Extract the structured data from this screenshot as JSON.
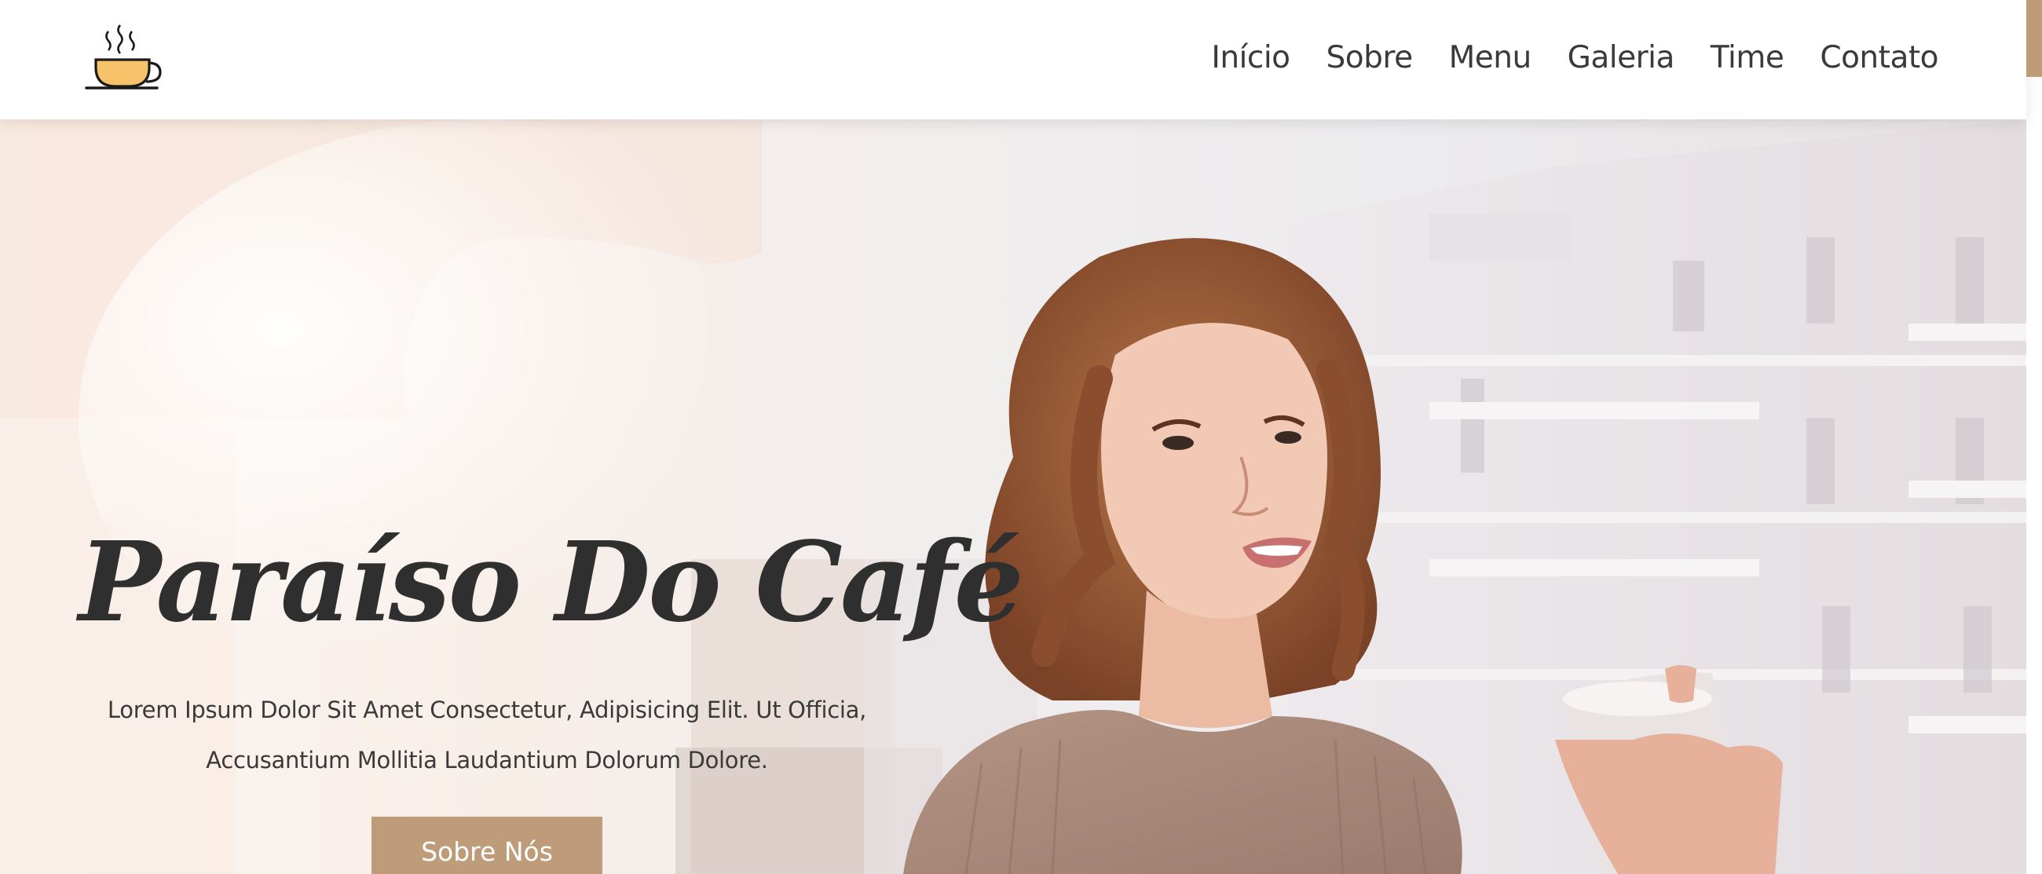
{
  "header": {
    "logo_icon": "coffee-cup-icon",
    "nav": [
      {
        "label": "Início"
      },
      {
        "label": "Sobre"
      },
      {
        "label": "Menu"
      },
      {
        "label": "Galeria"
      },
      {
        "label": "Time"
      },
      {
        "label": "Contato"
      }
    ]
  },
  "hero": {
    "title": "Paraíso Do Café",
    "text_line1": "Lorem Ipsum Dolor Sit Amet Consectetur, Adipisicing Elit. Ut Officia,",
    "text_line2": "Accusantium Mollitia Laudantium Dolorum Dolore.",
    "button_label": "Sobre Nós",
    "background_image": "woman-drinking-coffee-on-balcony-photo"
  },
  "colors": {
    "accent": "#be9c79",
    "text_dark": "#2f2f2f",
    "cup": "#f6c36b"
  }
}
